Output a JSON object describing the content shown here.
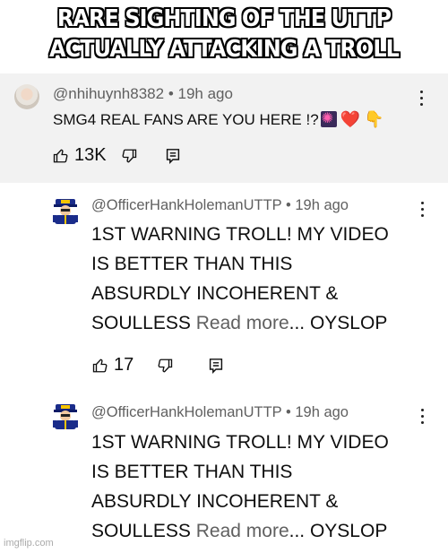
{
  "meme": {
    "caption_line1": "RARE SIGHTING OF THE UTTP",
    "caption_line2": "ACTUALLY ATTACKING A TROLL"
  },
  "comment": {
    "handle": "@nhihuynh8382",
    "time": "19h ago",
    "separator": "•",
    "text": "SMG4 REAL FANS ARE YOU HERE !?",
    "likes": "13K"
  },
  "replies": [
    {
      "handle": "@OfficerHankHolemanUTTP",
      "time": "19h ago",
      "separator": "•",
      "line1": "1ST WARNING TROLL! MY VIDEO",
      "line2": "IS BETTER THAN THIS",
      "line3": "ABSURDLY INCOHERENT &",
      "line4_a": "SOULLESS ",
      "read_more": "Read more",
      "line4_b": "... OYSLOP",
      "likes": "17"
    },
    {
      "handle": "@OfficerHankHolemanUTTP",
      "time": "19h ago",
      "separator": "•",
      "line1": "1ST WARNING TROLL! MY VIDEO",
      "line2": "IS BETTER THAN THIS",
      "line3": "ABSURDLY INCOHERENT &",
      "line4_a": "SOULLESS ",
      "read_more": "Read more",
      "line4_b": "... OYSLOP"
    }
  ],
  "watermark": "imgflip.com",
  "icons": [
    "kebab-menu-icon",
    "thumbs-up-icon",
    "thumbs-down-icon",
    "reply-icon",
    "firework-emoji",
    "heart-emoji",
    "pointing-down-emoji"
  ]
}
